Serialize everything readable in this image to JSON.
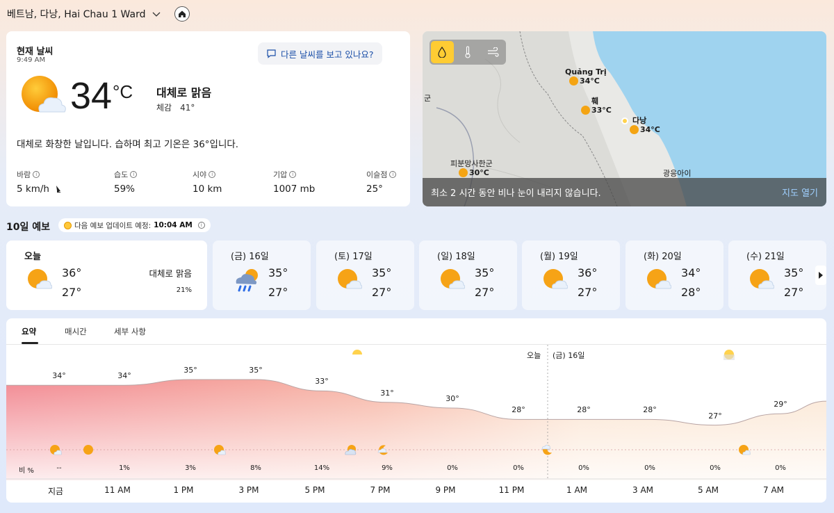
{
  "location": {
    "name": "베트남, 다낭, Hai Chau 1 Ward"
  },
  "current": {
    "title": "현재 날씨",
    "time": "9:49 AM",
    "other_weather_btn": "다른 날씨를 보고 있나요?",
    "temp": "34",
    "unit": "°C",
    "condition": "대체로 맑음",
    "feels_label": "체감",
    "feels_value": "41°",
    "summary": "대체로 화창한 날입니다. 습하며 최고 기온은 36°입니다.",
    "stats": [
      {
        "label": "바람",
        "value": "5 km/h"
      },
      {
        "label": "습도",
        "value": "59%"
      },
      {
        "label": "시야",
        "value": "10 km"
      },
      {
        "label": "기압",
        "value": "1007 mb"
      },
      {
        "label": "이슬점",
        "value": "25°"
      }
    ]
  },
  "map": {
    "cities": [
      {
        "name": "Quảng Trị",
        "temp": "34°C"
      },
      {
        "name": "훼",
        "temp": "33°C"
      },
      {
        "name": "다낭",
        "temp": "34°C"
      },
      {
        "name": "피분망사한군",
        "temp": "30°C"
      },
      {
        "name": "광응아이",
        "temp": ""
      },
      {
        "name": "군",
        "temp": ""
      }
    ],
    "message": "최소 2 시간 동안 비나 눈이 내리지 않습니다.",
    "open_link": "지도 열기"
  },
  "forecast": {
    "title": "10일 예보",
    "update_prefix": "다음 예보 업데이트 예정:",
    "update_time": "10:04 AM",
    "days": [
      {
        "name": "오늘",
        "hi": "36°",
        "lo": "27°",
        "cond": "대체로 맑음",
        "pct": "21%",
        "icon": "sun-cloud-icon"
      },
      {
        "name": "(금) 16일",
        "hi": "35°",
        "lo": "27°",
        "icon": "rain-cloud-icon"
      },
      {
        "name": "(토) 17일",
        "hi": "35°",
        "lo": "27°",
        "icon": "sun-cloud-icon"
      },
      {
        "name": "(일) 18일",
        "hi": "35°",
        "lo": "27°",
        "icon": "sun-cloud-icon"
      },
      {
        "name": "(월) 19일",
        "hi": "36°",
        "lo": "27°",
        "icon": "sun-cloud-icon"
      },
      {
        "name": "(화) 20일",
        "hi": "34°",
        "lo": "28°",
        "icon": "sun-cloud-icon"
      },
      {
        "name": "(수) 21일",
        "hi": "35°",
        "lo": "27°",
        "icon": "sun-cloud-icon"
      }
    ]
  },
  "hourly": {
    "tabs": [
      "요약",
      "매시간",
      "세부 사항"
    ],
    "day_marker_today": "오늘",
    "day_marker_next": "(금) 16일",
    "rain_title": "비 %",
    "temps": [
      "34°",
      "34°",
      "35°",
      "35°",
      "33°",
      "31°",
      "30°",
      "28°",
      "28°",
      "28°",
      "27°",
      "29°"
    ],
    "rain": [
      "--",
      "1%",
      "3%",
      "8%",
      "14%",
      "9%",
      "0%",
      "0%",
      "0%",
      "0%",
      "0%",
      "0%"
    ],
    "times": [
      "지금",
      "11 AM",
      "1 PM",
      "3 PM",
      "5 PM",
      "7 PM",
      "9 PM",
      "11 PM",
      "1 AM",
      "3 AM",
      "5 AM",
      "7 AM"
    ],
    "temp_values": [
      34,
      34,
      35,
      35,
      33,
      31,
      30,
      28,
      28,
      28,
      27,
      29
    ]
  }
}
